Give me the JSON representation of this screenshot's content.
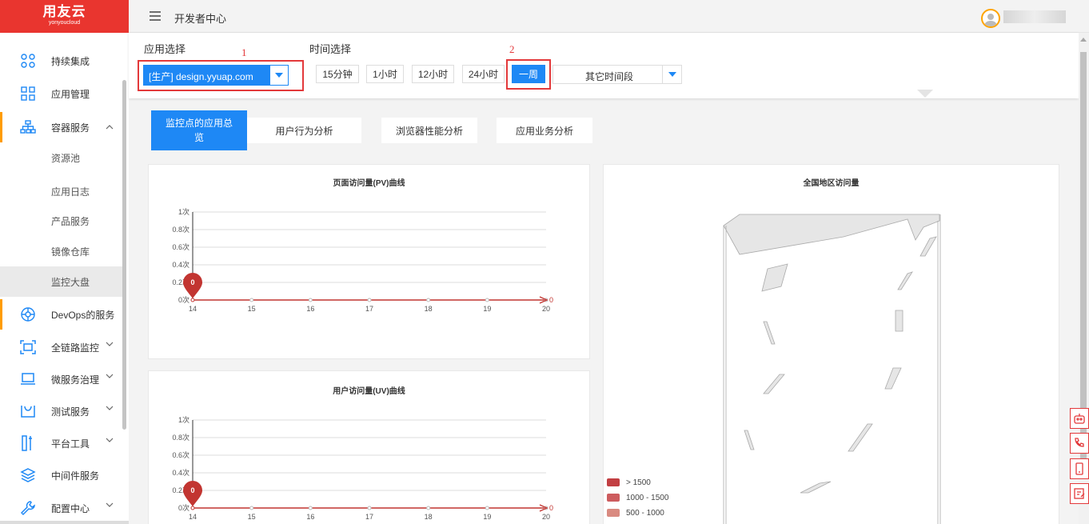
{
  "brand": {
    "name": "用友云",
    "sub": "yonyoucloud"
  },
  "header": {
    "title": "开发者中心"
  },
  "sidebar": {
    "items": [
      {
        "label": "持续集成",
        "icon": "ci-icon"
      },
      {
        "label": "应用管理",
        "icon": "grid-icon"
      },
      {
        "label": "容器服务",
        "icon": "sitemap-icon",
        "expanded": true
      },
      {
        "label": "DevOps的服务",
        "icon": "ring-icon"
      },
      {
        "label": "全链路监控",
        "icon": "monitor-frame-icon"
      },
      {
        "label": "微服务治理",
        "icon": "laptop-icon"
      },
      {
        "label": "测试服务",
        "icon": "tray-icon"
      },
      {
        "label": "平台工具",
        "icon": "tools-icon"
      },
      {
        "label": "中间件服务",
        "icon": "layers-icon"
      },
      {
        "label": "配置中心",
        "icon": "wrench-icon"
      }
    ],
    "sub_items": [
      "资源池",
      "应用日志",
      "产品服务",
      "镜像仓库",
      "监控大盘"
    ],
    "selected_sub": "监控大盘"
  },
  "filter": {
    "app_label": "应用选择",
    "app_value": "[生产] design.yyuap.com",
    "time_label": "时间选择",
    "time_options": [
      "15分钟",
      "1小时",
      "12小时",
      "24小时",
      "一周"
    ],
    "selected_time": "一周",
    "other_period": "其它时间段",
    "markers": [
      "1",
      "2"
    ]
  },
  "tabs": [
    "监控点的应用总览",
    "用户行为分析",
    "浏览器性能分析",
    "应用业务分析"
  ],
  "active_tab": "监控点的应用总览",
  "map": {
    "title": "全国地区访问量",
    "legend": [
      {
        "label": "> 1500",
        "color": "#c23f42"
      },
      {
        "label": "1000 - 1500",
        "color": "#cd5c5e"
      },
      {
        "label": "500 - 1000",
        "color": "#d98a80"
      }
    ]
  },
  "colors": {
    "accent": "#1e88f5",
    "brand": "#e9352f",
    "highlight": "#e3393b",
    "series": "#c23531"
  },
  "chart_data": [
    {
      "type": "line",
      "title": "页面访问量(PV)曲线",
      "x": [
        "14",
        "15",
        "16",
        "17",
        "18",
        "19",
        "20"
      ],
      "ytick_labels": [
        "1次",
        "0.8次",
        "0.6次",
        "0.4次",
        "0.2次",
        "0次"
      ],
      "ylim": [
        0,
        1
      ],
      "series": [
        {
          "values": [
            0,
            0,
            0,
            0,
            0,
            0,
            0
          ]
        }
      ],
      "markers": {
        "first": "0",
        "last": "0"
      },
      "grid": true
    },
    {
      "type": "line",
      "title": "用户访问量(UV)曲线",
      "x": [
        "14",
        "15",
        "16",
        "17",
        "18",
        "19",
        "20"
      ],
      "ytick_labels": [
        "1次",
        "0.8次",
        "0.6次",
        "0.4次",
        "0.2次",
        "0次"
      ],
      "ylim": [
        0,
        1
      ],
      "series": [
        {
          "values": [
            0,
            0,
            0,
            0,
            0,
            0,
            0
          ]
        }
      ],
      "markers": {
        "first": "0",
        "last": "0"
      },
      "grid": true
    }
  ]
}
